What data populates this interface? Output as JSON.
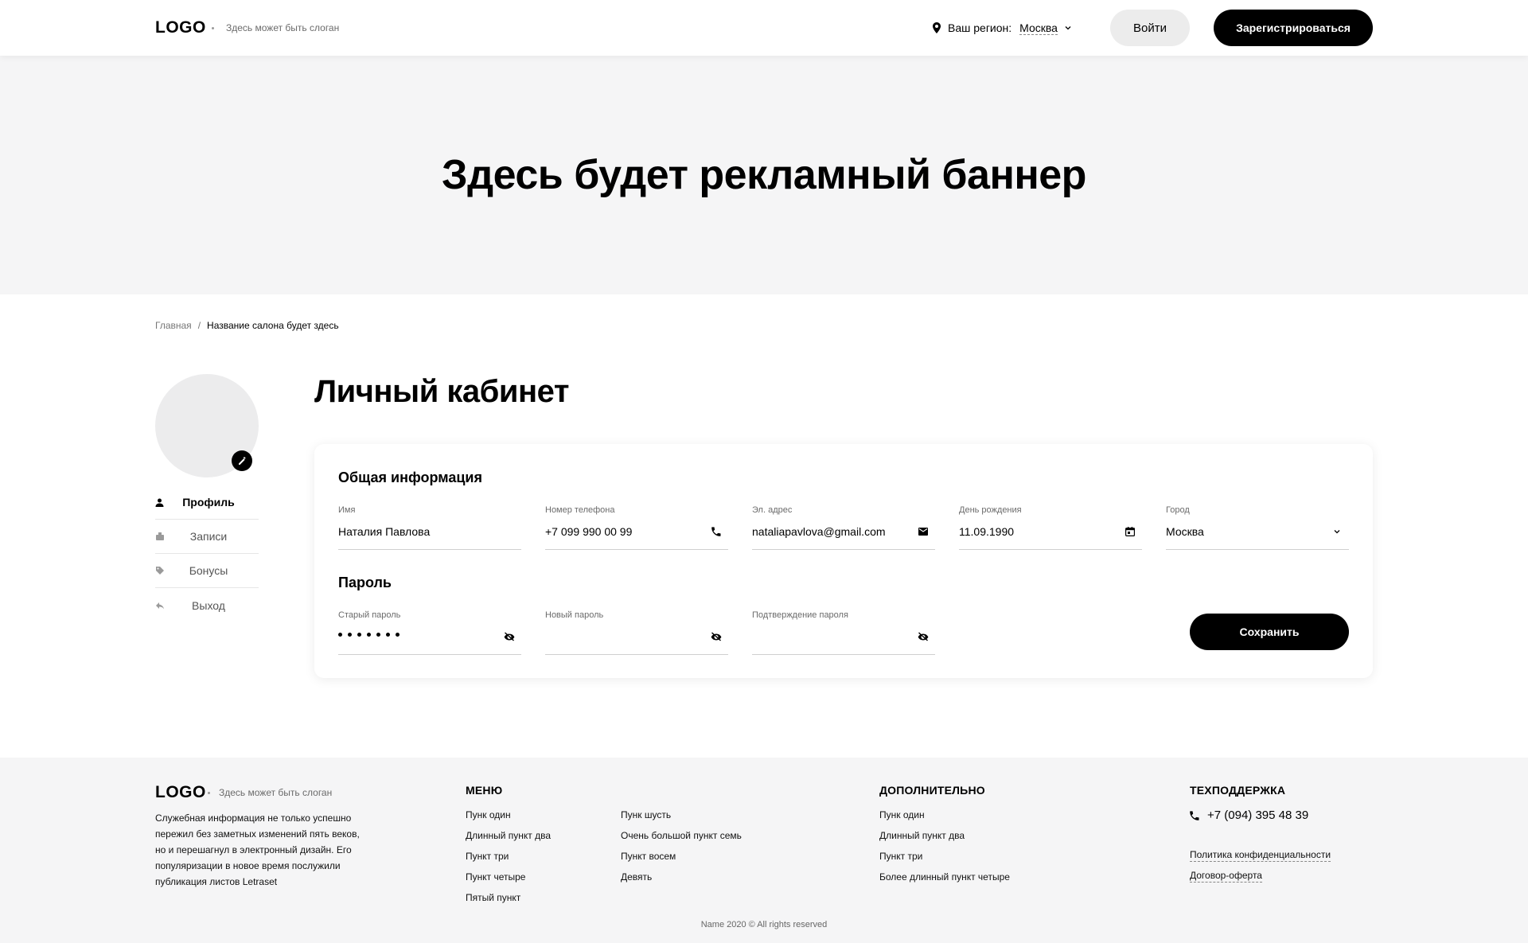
{
  "header": {
    "logo": "LOGO",
    "slogan": "Здесь может быть слоган",
    "region_label": "Ваш регион:",
    "region_value": "Москва",
    "login_label": "Войти",
    "register_label": "Зарегистрироваться"
  },
  "banner": {
    "text": "Здесь будет рекламный баннер"
  },
  "breadcrumb": {
    "home": "Главная",
    "separator": "/",
    "current": "Название салона будет здесь"
  },
  "sidebar": {
    "items": [
      {
        "label": "Профиль",
        "icon": "user-icon",
        "active": true
      },
      {
        "label": "Записи",
        "icon": "records-icon",
        "active": false
      },
      {
        "label": "Бонусы",
        "icon": "tag-icon",
        "active": false
      },
      {
        "label": "Выход",
        "icon": "exit-icon",
        "active": false
      }
    ]
  },
  "main": {
    "title": "Личный кабинет",
    "general": {
      "title": "Общая информация",
      "fields": {
        "name": {
          "label": "Имя",
          "value": "Наталия Павлова"
        },
        "phone": {
          "label": "Номер телефона",
          "value": "+7 099 990 00 99",
          "icon": "phone-icon"
        },
        "email": {
          "label": "Эл. адрес",
          "value": "nataliapavlova@gmail.com",
          "icon": "mail-icon"
        },
        "birthday": {
          "label": "День рождения",
          "value": "11.09.1990",
          "icon": "calendar-icon"
        },
        "city": {
          "label": "Город",
          "value": "Москва",
          "icon": "chevron-down-icon"
        }
      }
    },
    "password": {
      "title": "Пароль",
      "fields": {
        "old": {
          "label": "Старый пароль",
          "masked_length": 7,
          "icon": "eye-off-icon"
        },
        "new": {
          "label": "Новый пароль",
          "icon": "eye-off-icon"
        },
        "confirm": {
          "label": "Подтверждение пароля",
          "icon": "eye-off-icon"
        }
      }
    },
    "save_label": "Сохранить"
  },
  "footer": {
    "logo": "LOGO",
    "slogan": "Здесь может быть слоган",
    "about": "Служебная информация не только успешно пережил без заметных изменений пять веков, но и перешагнул в электронный дизайн. Его популяризации в новое время послужили публикация листов Letraset",
    "menu": {
      "title": "МЕНЮ",
      "col1": [
        "Пунк один",
        "Длинный пункт два",
        "Пункт три",
        "Пункт четыре",
        "Пятый пункт"
      ],
      "col2": [
        "Пунк шусть",
        "Очень большой пункт семь",
        "Пункт восем",
        "Девять"
      ]
    },
    "extra": {
      "title": "ДОПОЛНИТЕЛЬНО",
      "items": [
        "Пунк один",
        "Длинный пункт два",
        "Пункт три",
        "Более длинный пункт четыре"
      ]
    },
    "support": {
      "title": "ТЕХПОДДЕРЖКА",
      "phone": "+7 (094) 395 48 39",
      "privacy": "Политика конфиденциальности",
      "offer": "Договор-оферта"
    },
    "copyright": "Name 2020 © All rights reserved"
  },
  "colors": {
    "accent": "#000000",
    "banner_bg": "#f5f5f6",
    "footer_bg": "#f5f5f6",
    "avatar_bg": "#ececed"
  }
}
